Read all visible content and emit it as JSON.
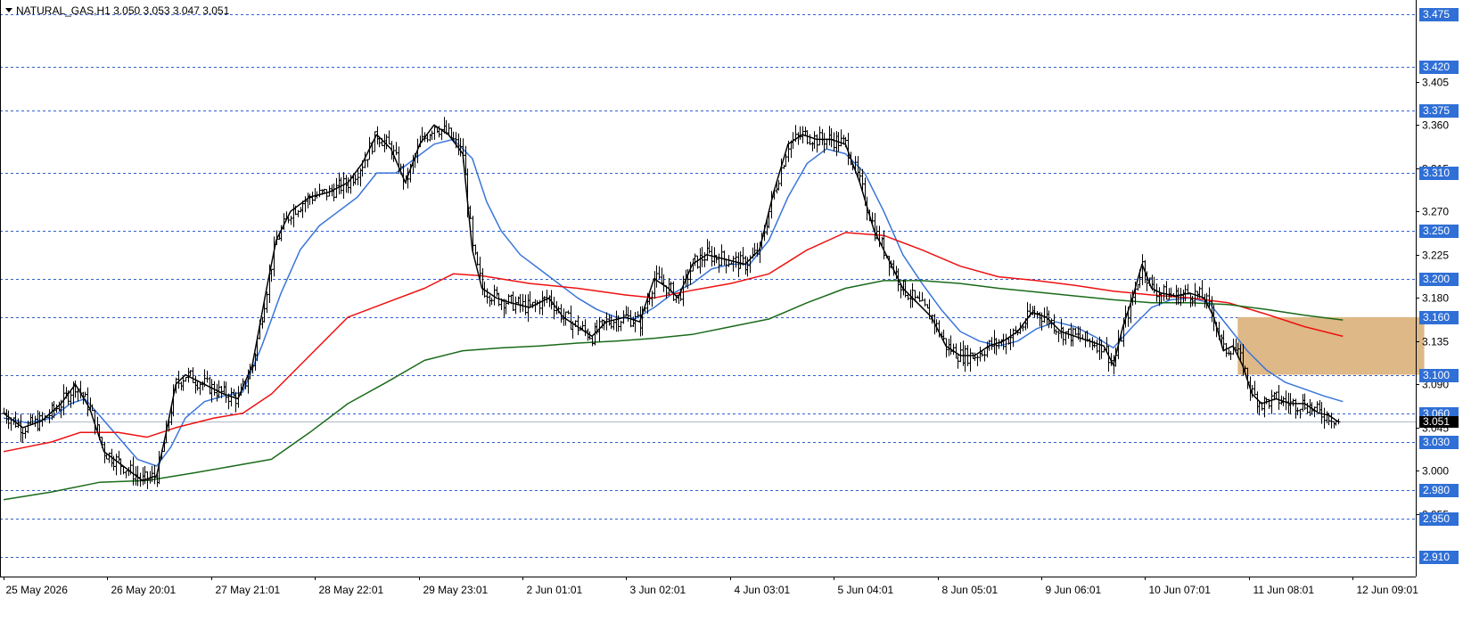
{
  "chart_data": {
    "type": "line",
    "title": "NATURAL_GAS,H1  3.050 3.053 3.047 3.051",
    "current_price": "3.051",
    "colors": {
      "price": "#000000",
      "ma_fast": "#000000",
      "ma_blue": "#3a76d8",
      "ma_red": "#ee1111",
      "ma_green": "#1a6a1a",
      "level_line": "#3060d0",
      "level_badge": "#2f6fd6",
      "zone": "#deb887",
      "current_badge": "#000000"
    },
    "ylim": [
      2.89,
      3.49
    ],
    "y_ticks": [
      "3.405",
      "3.360",
      "3.315",
      "3.270",
      "3.225",
      "3.180",
      "3.135",
      "3.090",
      "3.045",
      "3.000",
      "2.955"
    ],
    "levels": [
      "3.475",
      "3.420",
      "3.375",
      "3.310",
      "3.250",
      "3.200",
      "3.160",
      "3.100",
      "3.060",
      "3.030",
      "2.980",
      "2.950",
      "2.910"
    ],
    "x_labels": [
      "25 May 2026",
      "26 May 20:01",
      "27 May 21:01",
      "28 May 22:01",
      "29 May 23:01",
      "2 Jun 01:01",
      "3 Jun 02:01",
      "4 Jun 03:01",
      "5 Jun 04:01",
      "8 Jun 05:01",
      "9 Jun 06:01",
      "10 Jun 07:01",
      "11 Jun 08:01",
      "12 Jun 09:01"
    ],
    "x_range": [
      0,
      290
    ],
    "price_anchors": [
      {
        "x": 0,
        "y": 3.06
      },
      {
        "x": 4,
        "y": 3.045
      },
      {
        "x": 8,
        "y": 3.052
      },
      {
        "x": 12,
        "y": 3.07
      },
      {
        "x": 15,
        "y": 3.09
      },
      {
        "x": 18,
        "y": 3.065
      },
      {
        "x": 21,
        "y": 3.02
      },
      {
        "x": 25,
        "y": 3.005
      },
      {
        "x": 29,
        "y": 2.99
      },
      {
        "x": 32,
        "y": 2.995
      },
      {
        "x": 34,
        "y": 3.04
      },
      {
        "x": 36,
        "y": 3.09
      },
      {
        "x": 38,
        "y": 3.1
      },
      {
        "x": 42,
        "y": 3.09
      },
      {
        "x": 46,
        "y": 3.08
      },
      {
        "x": 49,
        "y": 3.075
      },
      {
        "x": 52,
        "y": 3.11
      },
      {
        "x": 55,
        "y": 3.19
      },
      {
        "x": 57,
        "y": 3.24
      },
      {
        "x": 60,
        "y": 3.27
      },
      {
        "x": 64,
        "y": 3.285
      },
      {
        "x": 68,
        "y": 3.29
      },
      {
        "x": 72,
        "y": 3.3
      },
      {
        "x": 75,
        "y": 3.32
      },
      {
        "x": 78,
        "y": 3.35
      },
      {
        "x": 81,
        "y": 3.335
      },
      {
        "x": 84,
        "y": 3.3
      },
      {
        "x": 87,
        "y": 3.34
      },
      {
        "x": 90,
        "y": 3.36
      },
      {
        "x": 93,
        "y": 3.35
      },
      {
        "x": 96,
        "y": 3.33
      },
      {
        "x": 98,
        "y": 3.23
      },
      {
        "x": 100,
        "y": 3.19
      },
      {
        "x": 103,
        "y": 3.18
      },
      {
        "x": 106,
        "y": 3.175
      },
      {
        "x": 110,
        "y": 3.17
      },
      {
        "x": 114,
        "y": 3.18
      },
      {
        "x": 117,
        "y": 3.16
      },
      {
        "x": 120,
        "y": 3.15
      },
      {
        "x": 123,
        "y": 3.14
      },
      {
        "x": 126,
        "y": 3.155
      },
      {
        "x": 130,
        "y": 3.16
      },
      {
        "x": 133,
        "y": 3.155
      },
      {
        "x": 136,
        "y": 3.2
      },
      {
        "x": 139,
        "y": 3.19
      },
      {
        "x": 141,
        "y": 3.18
      },
      {
        "x": 144,
        "y": 3.215
      },
      {
        "x": 147,
        "y": 3.225
      },
      {
        "x": 151,
        "y": 3.22
      },
      {
        "x": 155,
        "y": 3.215
      },
      {
        "x": 158,
        "y": 3.23
      },
      {
        "x": 161,
        "y": 3.29
      },
      {
        "x": 164,
        "y": 3.34
      },
      {
        "x": 167,
        "y": 3.35
      },
      {
        "x": 170,
        "y": 3.345
      },
      {
        "x": 173,
        "y": 3.345
      },
      {
        "x": 176,
        "y": 3.34
      },
      {
        "x": 179,
        "y": 3.3
      },
      {
        "x": 182,
        "y": 3.25
      },
      {
        "x": 185,
        "y": 3.22
      },
      {
        "x": 188,
        "y": 3.19
      },
      {
        "x": 191,
        "y": 3.175
      },
      {
        "x": 194,
        "y": 3.16
      },
      {
        "x": 197,
        "y": 3.13
      },
      {
        "x": 200,
        "y": 3.12
      },
      {
        "x": 203,
        "y": 3.12
      },
      {
        "x": 206,
        "y": 3.13
      },
      {
        "x": 209,
        "y": 3.135
      },
      {
        "x": 212,
        "y": 3.145
      },
      {
        "x": 215,
        "y": 3.165
      },
      {
        "x": 218,
        "y": 3.16
      },
      {
        "x": 221,
        "y": 3.145
      },
      {
        "x": 224,
        "y": 3.14
      },
      {
        "x": 227,
        "y": 3.135
      },
      {
        "x": 230,
        "y": 3.13
      },
      {
        "x": 232,
        "y": 3.11
      },
      {
        "x": 234,
        "y": 3.15
      },
      {
        "x": 236,
        "y": 3.18
      },
      {
        "x": 238,
        "y": 3.215
      },
      {
        "x": 240,
        "y": 3.19
      },
      {
        "x": 242,
        "y": 3.185
      },
      {
        "x": 245,
        "y": 3.182
      },
      {
        "x": 248,
        "y": 3.185
      },
      {
        "x": 251,
        "y": 3.18
      },
      {
        "x": 253,
        "y": 3.16
      },
      {
        "x": 255,
        "y": 3.125
      },
      {
        "x": 257,
        "y": 3.13
      },
      {
        "x": 259,
        "y": 3.11
      },
      {
        "x": 261,
        "y": 3.08
      },
      {
        "x": 263,
        "y": 3.07
      },
      {
        "x": 266,
        "y": 3.075
      },
      {
        "x": 269,
        "y": 3.07
      },
      {
        "x": 272,
        "y": 3.07
      },
      {
        "x": 275,
        "y": 3.06
      },
      {
        "x": 277,
        "y": 3.058
      },
      {
        "x": 279,
        "y": 3.051
      }
    ],
    "series": [
      {
        "values": [
          {
            "x": 0,
            "y": 3.055
          },
          {
            "x": 5,
            "y": 3.05
          },
          {
            "x": 10,
            "y": 3.055
          },
          {
            "x": 14,
            "y": 3.07
          },
          {
            "x": 17,
            "y": 3.075
          },
          {
            "x": 20,
            "y": 3.058
          },
          {
            "x": 24,
            "y": 3.035
          },
          {
            "x": 28,
            "y": 3.012
          },
          {
            "x": 32,
            "y": 3.005
          },
          {
            "x": 35,
            "y": 3.025
          },
          {
            "x": 38,
            "y": 3.055
          },
          {
            "x": 42,
            "y": 3.072
          },
          {
            "x": 46,
            "y": 3.078
          },
          {
            "x": 50,
            "y": 3.082
          },
          {
            "x": 54,
            "y": 3.13
          },
          {
            "x": 58,
            "y": 3.185
          },
          {
            "x": 62,
            "y": 3.23
          },
          {
            "x": 66,
            "y": 3.255
          },
          {
            "x": 70,
            "y": 3.27
          },
          {
            "x": 74,
            "y": 3.285
          },
          {
            "x": 78,
            "y": 3.31
          },
          {
            "x": 82,
            "y": 3.31
          },
          {
            "x": 86,
            "y": 3.325
          },
          {
            "x": 90,
            "y": 3.34
          },
          {
            "x": 94,
            "y": 3.345
          },
          {
            "x": 98,
            "y": 3.325
          },
          {
            "x": 101,
            "y": 3.28
          },
          {
            "x": 104,
            "y": 3.25
          },
          {
            "x": 108,
            "y": 3.225
          },
          {
            "x": 112,
            "y": 3.21
          },
          {
            "x": 116,
            "y": 3.195
          },
          {
            "x": 120,
            "y": 3.18
          },
          {
            "x": 124,
            "y": 3.168
          },
          {
            "x": 128,
            "y": 3.16
          },
          {
            "x": 132,
            "y": 3.158
          },
          {
            "x": 136,
            "y": 3.17
          },
          {
            "x": 140,
            "y": 3.185
          },
          {
            "x": 144,
            "y": 3.195
          },
          {
            "x": 148,
            "y": 3.21
          },
          {
            "x": 152,
            "y": 3.215
          },
          {
            "x": 156,
            "y": 3.215
          },
          {
            "x": 160,
            "y": 3.24
          },
          {
            "x": 164,
            "y": 3.285
          },
          {
            "x": 168,
            "y": 3.32
          },
          {
            "x": 172,
            "y": 3.335
          },
          {
            "x": 176,
            "y": 3.33
          },
          {
            "x": 180,
            "y": 3.31
          },
          {
            "x": 184,
            "y": 3.27
          },
          {
            "x": 188,
            "y": 3.225
          },
          {
            "x": 192,
            "y": 3.195
          },
          {
            "x": 196,
            "y": 3.168
          },
          {
            "x": 200,
            "y": 3.145
          },
          {
            "x": 204,
            "y": 3.135
          },
          {
            "x": 208,
            "y": 3.13
          },
          {
            "x": 212,
            "y": 3.135
          },
          {
            "x": 216,
            "y": 3.148
          },
          {
            "x": 220,
            "y": 3.155
          },
          {
            "x": 224,
            "y": 3.15
          },
          {
            "x": 228,
            "y": 3.14
          },
          {
            "x": 232,
            "y": 3.128
          },
          {
            "x": 236,
            "y": 3.15
          },
          {
            "x": 240,
            "y": 3.17
          },
          {
            "x": 244,
            "y": 3.178
          },
          {
            "x": 248,
            "y": 3.18
          },
          {
            "x": 252,
            "y": 3.175
          },
          {
            "x": 256,
            "y": 3.15
          },
          {
            "x": 260,
            "y": 3.125
          },
          {
            "x": 264,
            "y": 3.105
          },
          {
            "x": 268,
            "y": 3.092
          },
          {
            "x": 272,
            "y": 3.085
          },
          {
            "x": 276,
            "y": 3.078
          },
          {
            "x": 280,
            "y": 3.072
          }
        ]
      },
      {
        "values": [
          {
            "x": 0,
            "y": 3.02
          },
          {
            "x": 10,
            "y": 3.03
          },
          {
            "x": 16,
            "y": 3.04
          },
          {
            "x": 24,
            "y": 3.04
          },
          {
            "x": 30,
            "y": 3.035
          },
          {
            "x": 36,
            "y": 3.045
          },
          {
            "x": 44,
            "y": 3.055
          },
          {
            "x": 50,
            "y": 3.06
          },
          {
            "x": 56,
            "y": 3.08
          },
          {
            "x": 64,
            "y": 3.12
          },
          {
            "x": 72,
            "y": 3.16
          },
          {
            "x": 80,
            "y": 3.175
          },
          {
            "x": 88,
            "y": 3.19
          },
          {
            "x": 94,
            "y": 3.205
          },
          {
            "x": 100,
            "y": 3.203
          },
          {
            "x": 110,
            "y": 3.195
          },
          {
            "x": 120,
            "y": 3.19
          },
          {
            "x": 130,
            "y": 3.183
          },
          {
            "x": 136,
            "y": 3.18
          },
          {
            "x": 144,
            "y": 3.188
          },
          {
            "x": 152,
            "y": 3.195
          },
          {
            "x": 160,
            "y": 3.205
          },
          {
            "x": 168,
            "y": 3.23
          },
          {
            "x": 176,
            "y": 3.248
          },
          {
            "x": 184,
            "y": 3.245
          },
          {
            "x": 192,
            "y": 3.23
          },
          {
            "x": 200,
            "y": 3.213
          },
          {
            "x": 208,
            "y": 3.202
          },
          {
            "x": 216,
            "y": 3.198
          },
          {
            "x": 224,
            "y": 3.193
          },
          {
            "x": 232,
            "y": 3.187
          },
          {
            "x": 240,
            "y": 3.183
          },
          {
            "x": 248,
            "y": 3.18
          },
          {
            "x": 256,
            "y": 3.175
          },
          {
            "x": 264,
            "y": 3.163
          },
          {
            "x": 272,
            "y": 3.15
          },
          {
            "x": 280,
            "y": 3.14
          }
        ]
      },
      {
        "values": [
          {
            "x": 0,
            "y": 2.97
          },
          {
            "x": 10,
            "y": 2.978
          },
          {
            "x": 20,
            "y": 2.988
          },
          {
            "x": 30,
            "y": 2.99
          },
          {
            "x": 40,
            "y": 2.998
          },
          {
            "x": 48,
            "y": 3.005
          },
          {
            "x": 56,
            "y": 3.012
          },
          {
            "x": 64,
            "y": 3.04
          },
          {
            "x": 72,
            "y": 3.07
          },
          {
            "x": 80,
            "y": 3.092
          },
          {
            "x": 88,
            "y": 3.115
          },
          {
            "x": 96,
            "y": 3.125
          },
          {
            "x": 104,
            "y": 3.128
          },
          {
            "x": 112,
            "y": 3.13
          },
          {
            "x": 120,
            "y": 3.133
          },
          {
            "x": 128,
            "y": 3.135
          },
          {
            "x": 136,
            "y": 3.138
          },
          {
            "x": 144,
            "y": 3.142
          },
          {
            "x": 152,
            "y": 3.15
          },
          {
            "x": 160,
            "y": 3.158
          },
          {
            "x": 168,
            "y": 3.175
          },
          {
            "x": 176,
            "y": 3.19
          },
          {
            "x": 184,
            "y": 3.198
          },
          {
            "x": 192,
            "y": 3.198
          },
          {
            "x": 200,
            "y": 3.195
          },
          {
            "x": 208,
            "y": 3.19
          },
          {
            "x": 216,
            "y": 3.186
          },
          {
            "x": 224,
            "y": 3.182
          },
          {
            "x": 232,
            "y": 3.178
          },
          {
            "x": 240,
            "y": 3.175
          },
          {
            "x": 248,
            "y": 3.175
          },
          {
            "x": 256,
            "y": 3.173
          },
          {
            "x": 264,
            "y": 3.168
          },
          {
            "x": 272,
            "y": 3.162
          },
          {
            "x": 280,
            "y": 3.157
          }
        ]
      }
    ],
    "zone": {
      "x_start": 258,
      "x_end": 297,
      "y_low": 3.1,
      "y_high": 3.16
    }
  }
}
